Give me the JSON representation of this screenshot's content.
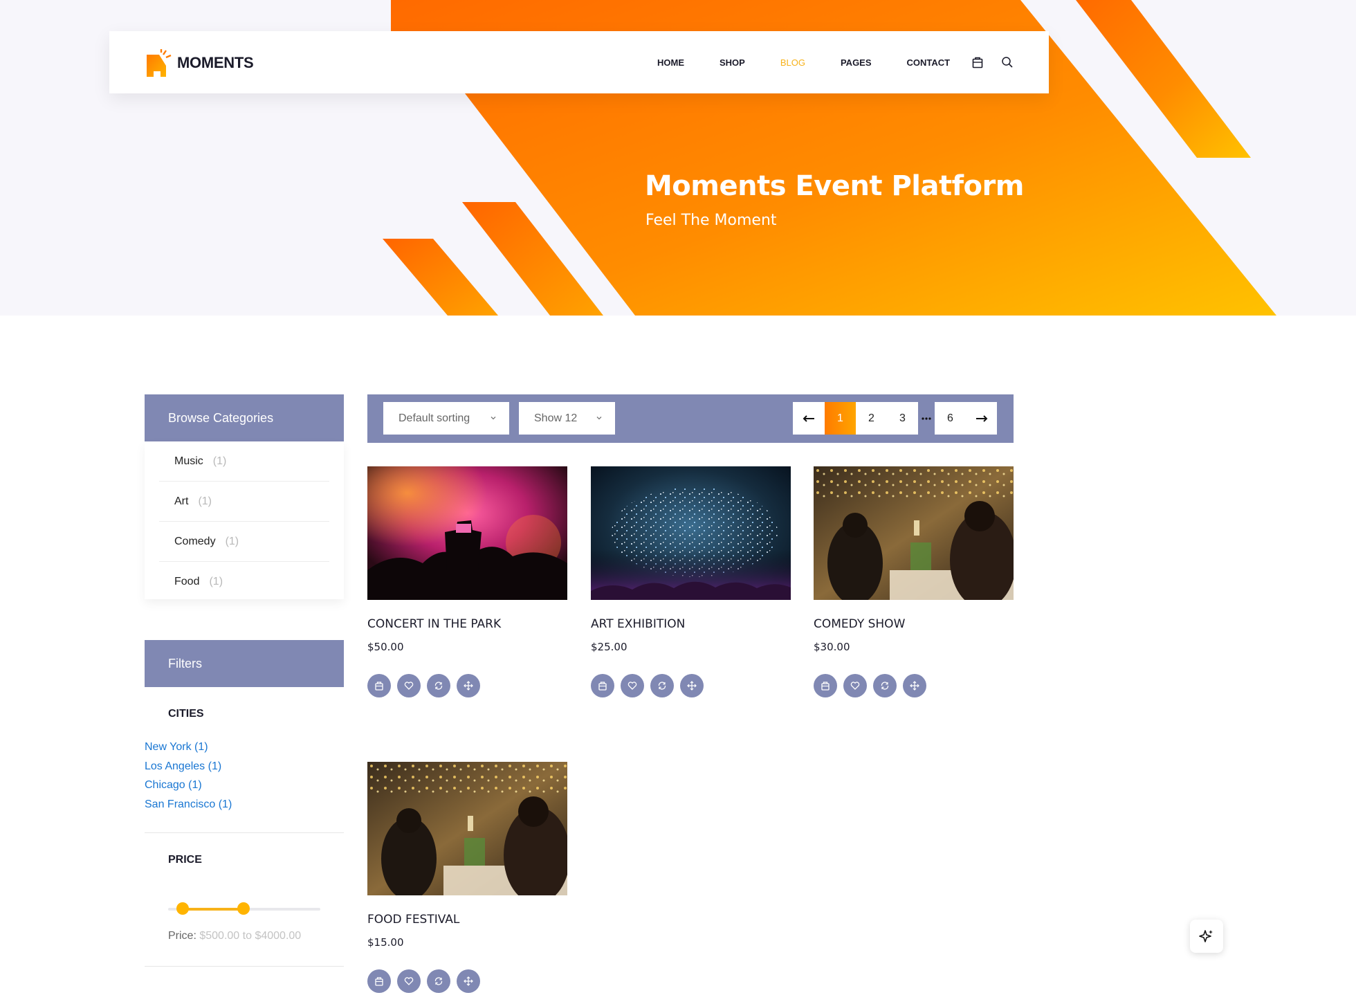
{
  "colors": {
    "accent": "#f7b21a",
    "panel": "#8088b3",
    "link": "#1976d2",
    "hero_orange": "#ff7200",
    "hero_yellow": "#ffb800"
  },
  "brand": {
    "name": "MOMENTS",
    "icon": "moments-logo-icon"
  },
  "nav": {
    "items": [
      {
        "label": "HOME"
      },
      {
        "label": "SHOP"
      },
      {
        "label": "BLOG",
        "active": true
      },
      {
        "label": "PAGES"
      },
      {
        "label": "CONTACT"
      }
    ],
    "cart_icon": "cart-icon",
    "search_icon": "search-icon"
  },
  "hero": {
    "title": "Moments Event Platform",
    "subtitle": "Feel The Moment"
  },
  "sidebar": {
    "categories_title": "Browse Categories",
    "categories": [
      {
        "name": "Music",
        "count": "(1)"
      },
      {
        "name": "Art",
        "count": "(1)"
      },
      {
        "name": "Comedy",
        "count": "(1)"
      },
      {
        "name": "Food",
        "count": "(1)"
      }
    ],
    "filters_title": "Filters",
    "cities_title": "CITIES",
    "cities": [
      "New York (1)",
      "Los Angeles (1)",
      "Chicago (1)",
      "San Francisco (1)"
    ],
    "price_title": "PRICE",
    "price": {
      "prefix": "Price:",
      "min": "$500.00",
      "connector": "to",
      "max": "$4000.00"
    }
  },
  "toolbar": {
    "sorting": "Default sorting",
    "show": "Show 12",
    "pagination": {
      "prev_icon": "arrow-left-icon",
      "pages": [
        "1",
        "2",
        "3",
        "6"
      ],
      "current": "1",
      "ellipsis_icon": "ellipsis-icon",
      "next_icon": "arrow-right-icon"
    }
  },
  "products": [
    {
      "title": "CONCERT IN THE PARK",
      "price": "$50.00",
      "image": "concert-crowd-photo"
    },
    {
      "title": "ART EXHIBITION",
      "price": "$25.00",
      "image": "confetti-celebration-photo"
    },
    {
      "title": "COMEDY SHOW",
      "price": "$30.00",
      "image": "dinner-party-photo"
    },
    {
      "title": "FOOD FESTIVAL",
      "price": "$15.00",
      "image": "dinner-party-photo"
    }
  ],
  "product_actions": [
    "cart-icon",
    "heart-icon",
    "compare-icon",
    "expand-icon"
  ],
  "floating_button_icon": "sparkle-icon"
}
